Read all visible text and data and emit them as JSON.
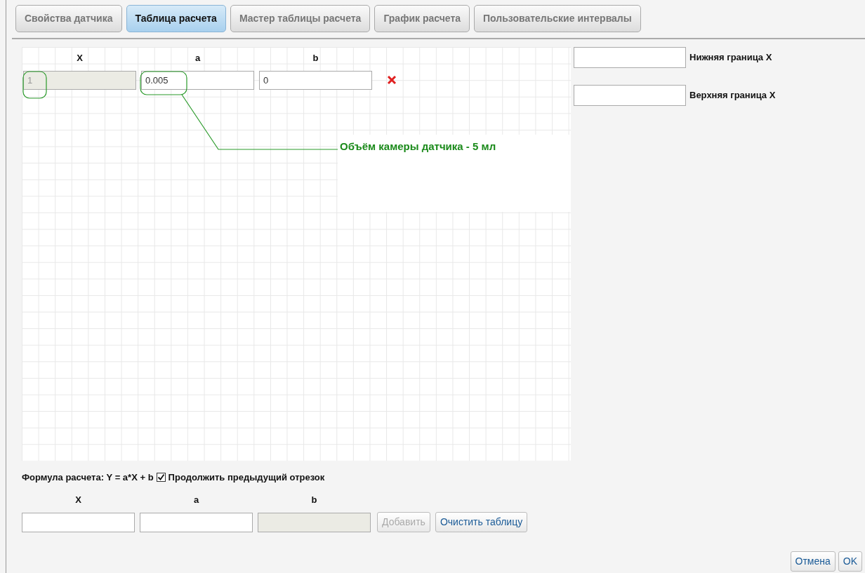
{
  "tabs": [
    {
      "label": "Свойства датчика",
      "selected": false
    },
    {
      "label": "Таблица расчета",
      "selected": true
    },
    {
      "label": "Мастер таблицы расчета",
      "selected": false
    },
    {
      "label": "График расчета",
      "selected": false
    },
    {
      "label": "Пользовательские интервалы",
      "selected": false
    }
  ],
  "table": {
    "columns": [
      "X",
      "a",
      "b"
    ],
    "rows": [
      {
        "cells": [
          {
            "value": "1",
            "disabled": true
          },
          {
            "value": "0.005",
            "disabled": false
          },
          {
            "value": "0",
            "disabled": false
          }
        ]
      }
    ]
  },
  "annotation": {
    "text": "Объём камеры датчика - 5 мл"
  },
  "bounds": [
    {
      "label": "Нижняя граница X"
    },
    {
      "label": "Верхняя граница X"
    }
  ],
  "formula": {
    "text": "Формула расчета: Y = a*X + b",
    "continue_checkbox": {
      "label": "Продолжить предыдущий отрезок",
      "checked": true
    }
  },
  "add_form": {
    "columns": [
      "X",
      "a",
      "b"
    ],
    "fields": [
      {
        "disabled": false
      },
      {
        "disabled": false
      },
      {
        "disabled": true
      }
    ],
    "buttons": [
      {
        "label": "Добавить",
        "disabled": true
      },
      {
        "label": "Очистить таблицу",
        "disabled": false
      }
    ]
  },
  "footer_buttons": [
    {
      "label": "Отмена"
    },
    {
      "label": "OK"
    }
  ]
}
